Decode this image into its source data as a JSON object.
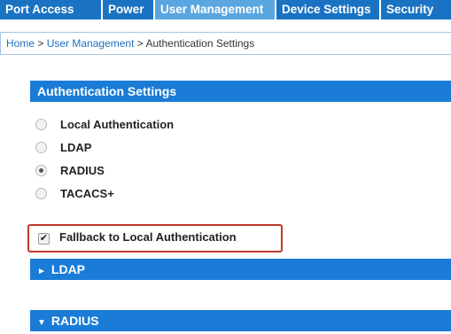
{
  "nav": {
    "tabs": [
      {
        "label": "Port Access"
      },
      {
        "label": "Power"
      },
      {
        "label": "User Management",
        "active": true
      },
      {
        "label": "Device Settings"
      },
      {
        "label": "Security"
      }
    ]
  },
  "breadcrumb": {
    "home": "Home",
    "sep1": ">",
    "user_management": "User Management",
    "sep2": ">",
    "current": "Authentication Settings"
  },
  "auth_settings": {
    "header": "Authentication Settings",
    "options": [
      {
        "label": "Local Authentication",
        "checked": false
      },
      {
        "label": "LDAP",
        "checked": false
      },
      {
        "label": "RADIUS",
        "checked": true
      },
      {
        "label": "TACACS+",
        "checked": false
      }
    ],
    "fallback": {
      "label": "Fallback to Local Authentication",
      "checked": true,
      "check_glyph": "✔"
    }
  },
  "sections": {
    "ldap": {
      "arrow": "►",
      "label": "LDAP"
    },
    "radius": {
      "arrow": "▼",
      "label": "RADIUS"
    }
  },
  "colors": {
    "tab_bg": "#1a73c2",
    "tab_active_bg": "#5aa6e0",
    "header_bg": "#1a7cd6",
    "highlight_border": "#c0392b",
    "link": "#1f6fc1"
  }
}
